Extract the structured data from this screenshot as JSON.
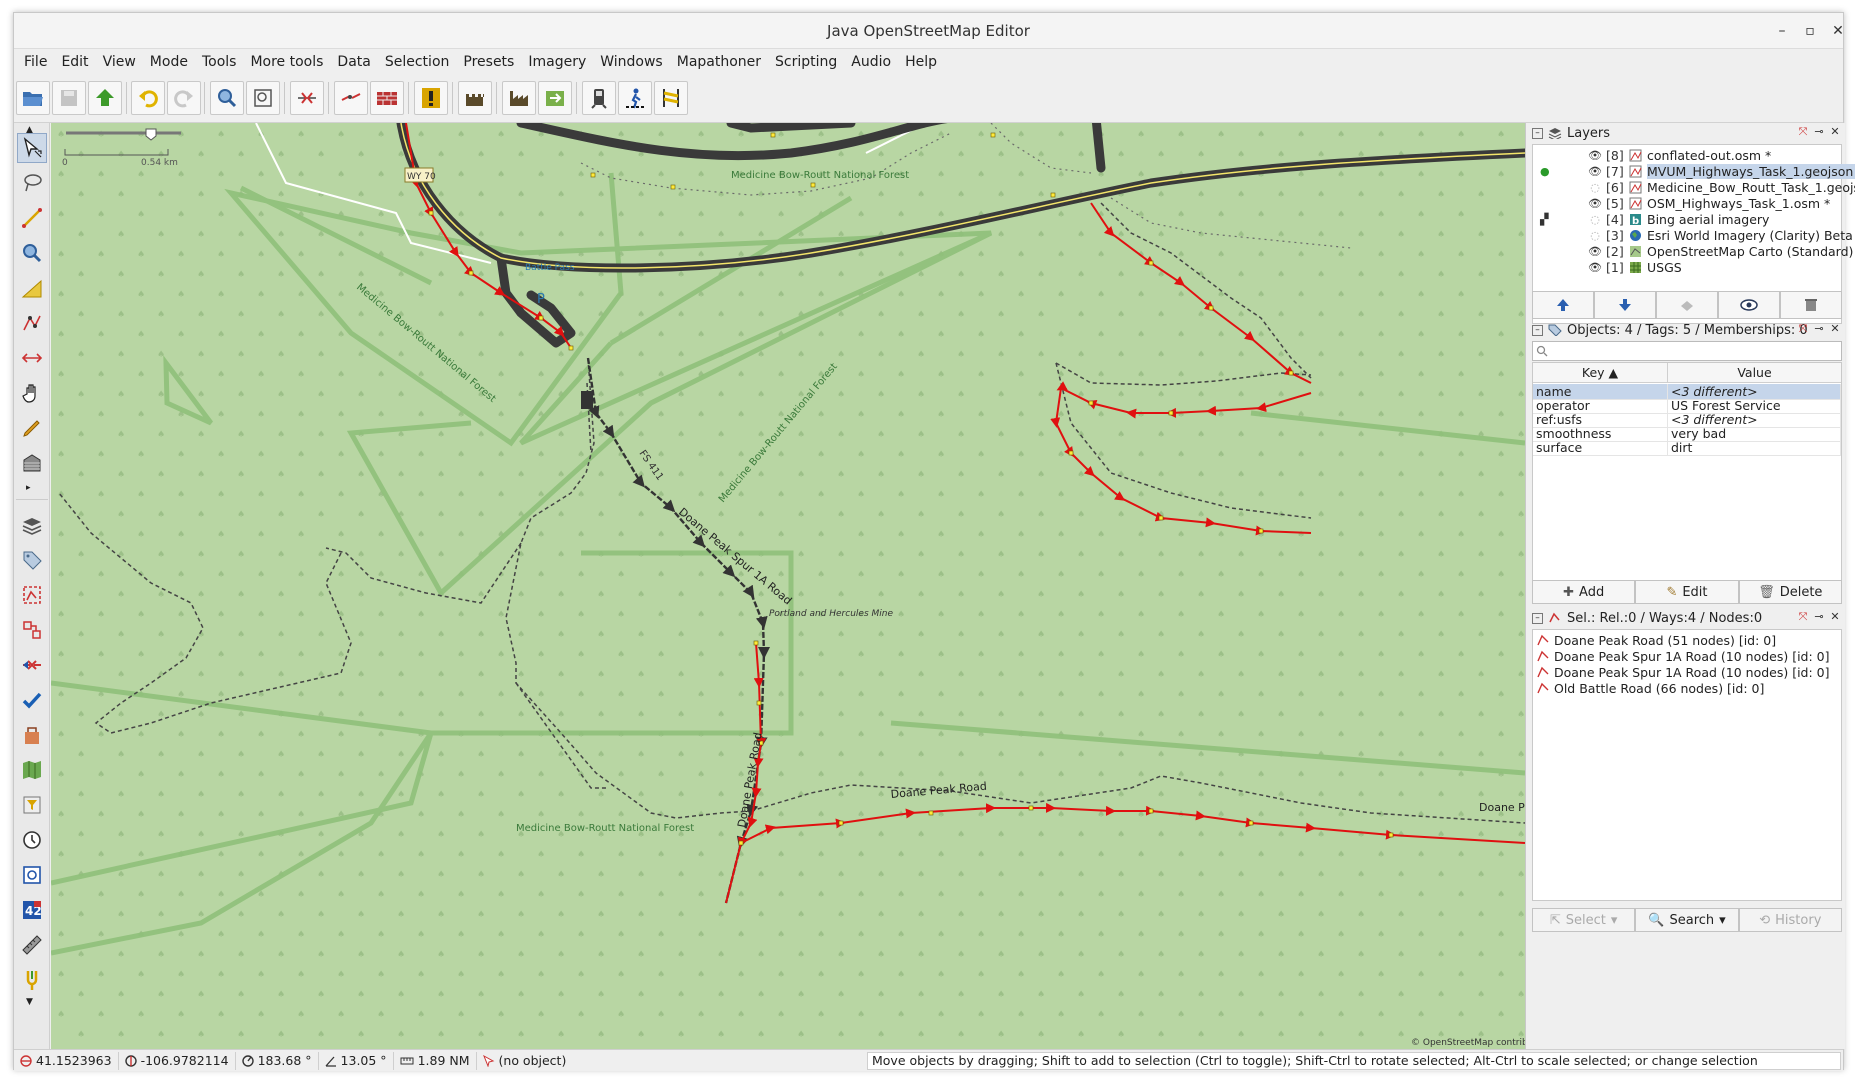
{
  "window": {
    "title": "Java OpenStreetMap Editor",
    "minimize": "–",
    "maximize": "▫",
    "close": "✕"
  },
  "menu": [
    "File",
    "Edit",
    "View",
    "Mode",
    "Tools",
    "More tools",
    "Data",
    "Selection",
    "Presets",
    "Imagery",
    "Windows",
    "Mapathoner",
    "Scripting",
    "Audio",
    "Help"
  ],
  "scale": {
    "zero": "0",
    "distance": "0.54 km"
  },
  "map_labels": {
    "forest_top": "Medicine Bow-Routt National Forest",
    "forest_diag1": "Medicine Bow-Routt National Forest",
    "forest_diag2": "Medicine Bow-Routt National Forest",
    "forest_bottom": "Medicine Bow-Routt National Forest",
    "battle_pass": "Battle Pass",
    "parking": "P",
    "fs411": "FS 411",
    "doane_spur": "Doane Peak Spur 1A Road",
    "mine": "Portland and Hercules Mine",
    "doane_peak_road": "Doane Peak Road",
    "doane_peak_road_v": "Doane Peak Road",
    "doane_peak_road_right": "Doane P",
    "wy70": "WY 70",
    "attribution": "© OpenStreetMap contributors"
  },
  "layers_panel": {
    "title": "Layers",
    "layers": [
      {
        "num": "[8]",
        "name": "conflated-out.osm *",
        "visible": true,
        "icon": "data-layer-icon"
      },
      {
        "num": "[7]",
        "name": "MVUM_Highways_Task_1.geojson",
        "visible": true,
        "icon": "data-layer-icon",
        "selected": true,
        "active": true
      },
      {
        "num": "[6]",
        "name": "Medicine_Bow_Routt_Task_1.geojson",
        "visible": false,
        "icon": "data-layer-icon"
      },
      {
        "num": "[5]",
        "name": "OSM_Highways_Task_1.osm *",
        "visible": true,
        "icon": "data-layer-icon"
      },
      {
        "num": "[4]",
        "name": "Bing aerial imagery",
        "visible": false,
        "icon": "bing-icon"
      },
      {
        "num": "[3]",
        "name": "Esri World Imagery (Clarity) Beta",
        "visible": false,
        "icon": "globe-icon"
      },
      {
        "num": "[2]",
        "name": "OpenStreetMap Carto (Standard)",
        "visible": true,
        "icon": "osm-icon"
      },
      {
        "num": "[1]",
        "name": "USGS",
        "visible": true,
        "icon": "grid-icon"
      }
    ]
  },
  "tags_panel": {
    "title": "Objects: 4 / Tags: 5 / Memberships: 0",
    "key_header": "Key ▲",
    "value_header": "Value",
    "rows": [
      {
        "key": "name",
        "value": "<3 different>",
        "italic": true
      },
      {
        "key": "operator",
        "value": "US Forest Service",
        "italic": false
      },
      {
        "key": "ref:usfs",
        "value": "<3 different>",
        "italic": true
      },
      {
        "key": "smoothness",
        "value": "very bad",
        "italic": false
      },
      {
        "key": "surface",
        "value": "dirt",
        "italic": false
      }
    ],
    "add": "Add",
    "edit": "Edit",
    "delete": "Delete"
  },
  "selection_panel": {
    "title": "Sel.: Rel.:0 / Ways:4 / Nodes:0",
    "items": [
      "Doane Peak Road (51 nodes) [id: 0]",
      "Doane Peak Spur 1A Road (10 nodes) [id: 0]",
      "Doane Peak Spur 1A Road (10 nodes) [id: 0]",
      "Old Battle Road (66 nodes) [id: 0]"
    ],
    "select": "Select",
    "search": "Search",
    "history": "History"
  },
  "status": {
    "lat": "41.1523963",
    "lon": "-106.9782114",
    "heading": "183.68 °",
    "angle": "13.05 °",
    "distance": "1.89 NM",
    "object": "(no object)",
    "help": "Move objects by dragging; Shift to add to selection (Ctrl to toggle); Shift-Ctrl to rotate selected; Alt-Ctrl to scale selected; or change selection"
  }
}
